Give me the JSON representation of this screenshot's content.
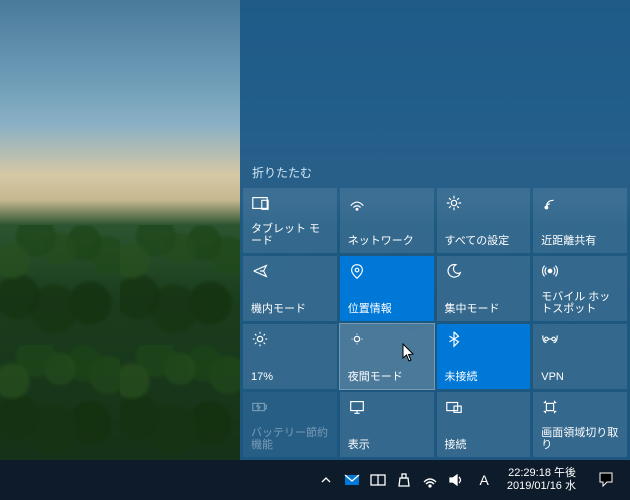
{
  "actionCenter": {
    "collapseLabel": "折りたたむ",
    "tiles": [
      {
        "id": "tablet",
        "label": "タブレット モード",
        "icon": "tablet",
        "state": "normal"
      },
      {
        "id": "network",
        "label": "ネットワーク",
        "icon": "network",
        "state": "normal"
      },
      {
        "id": "settings",
        "label": "すべての設定",
        "icon": "gear",
        "state": "normal"
      },
      {
        "id": "nearby",
        "label": "近距離共有",
        "icon": "share",
        "state": "normal"
      },
      {
        "id": "airplane",
        "label": "機内モード",
        "icon": "airplane",
        "state": "normal"
      },
      {
        "id": "location",
        "label": "位置情報",
        "icon": "location",
        "state": "active"
      },
      {
        "id": "focus",
        "label": "集中モード",
        "icon": "moon",
        "state": "normal"
      },
      {
        "id": "hotspot",
        "label": "モバイル ホットスポット",
        "icon": "hotspot",
        "state": "normal"
      },
      {
        "id": "brightness",
        "label": "17%",
        "icon": "sun",
        "state": "normal"
      },
      {
        "id": "nightlight",
        "label": "夜間モード",
        "icon": "sun-dim",
        "state": "hover"
      },
      {
        "id": "bluetooth",
        "label": "未接続",
        "icon": "bluetooth",
        "state": "active"
      },
      {
        "id": "vpn",
        "label": "VPN",
        "icon": "vpn",
        "state": "normal"
      },
      {
        "id": "battery",
        "label": "バッテリー節約機能",
        "icon": "battery",
        "state": "disabled"
      },
      {
        "id": "project",
        "label": "表示",
        "icon": "project",
        "state": "normal"
      },
      {
        "id": "connect",
        "label": "接続",
        "icon": "connect",
        "state": "normal"
      },
      {
        "id": "snip",
        "label": "画面領域切り取り",
        "icon": "snip",
        "state": "normal"
      }
    ]
  },
  "taskbar": {
    "ime": "A",
    "clockTime": "22:29:18 午後",
    "clockDate": "2019/01/16 水"
  }
}
